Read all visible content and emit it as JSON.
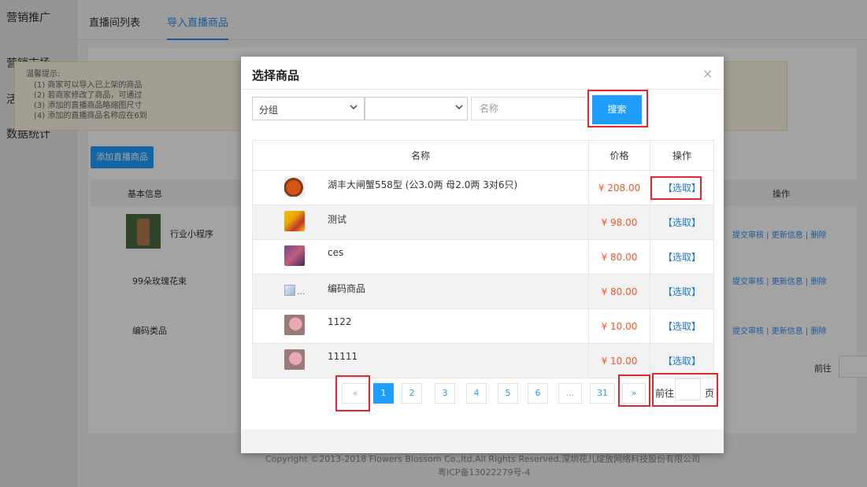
{
  "sidebar": {
    "items": [
      {
        "label": "营销推广"
      },
      {
        "label": "营销市场"
      },
      {
        "label": "活动管理"
      },
      {
        "label": "数据统计"
      }
    ]
  },
  "topbar": {
    "tabs": [
      {
        "label": "直播间列表",
        "active": false
      },
      {
        "label": "导入直播商品",
        "active": true
      }
    ]
  },
  "tips": {
    "title": "温馨提示:",
    "lines": [
      "(1) 商家可以导入已上架的商品",
      "(2) 若商家修改了商品，可通过",
      "(3) 添加的直播商品略缩图尺寸",
      "(4) 添加的直播商品名称应在6到"
    ]
  },
  "background_table": {
    "add_button": "添加直播商品",
    "col_basic": "基本信息",
    "col_op": "操作",
    "rows": [
      {
        "name": "行业小程序"
      },
      {
        "name": "99朵玫瑰花束"
      },
      {
        "name": "编码类品"
      }
    ],
    "row_links": "提交审核 | 更新信息 | 删除",
    "goto_label": "前往"
  },
  "footer": {
    "copyright": "Copyright ©2013-2018 Flowers Blossom Co.,ltd.All Rights Reserved.深圳花儿绽放网络科技股份有限公司",
    "icp": "粤ICP备13022279号-4"
  },
  "modal": {
    "title": "选择商品",
    "close": "×",
    "filter": {
      "group_value": "分组",
      "subgroup_value": "",
      "name_placeholder": "名称",
      "search_label": "搜索"
    },
    "table": {
      "headers": {
        "name": "名称",
        "price": "价格",
        "op": "操作"
      },
      "rows": [
        {
          "name": "湖丰大闸蟹558型 (公3.0两 母2.0两 3对6只)",
          "price": "¥ 208.00",
          "op": "【选取】",
          "thumb": "crab-image"
        },
        {
          "name": "测试",
          "price": "¥ 98.00",
          "op": "【选取】",
          "thumb": "yellow-food-image"
        },
        {
          "name": "ces",
          "price": "¥ 80.00",
          "op": "【选取】",
          "thumb": "purple-product-image"
        },
        {
          "name": "编码商品",
          "price": "¥ 80.00",
          "op": "【选取】",
          "thumb": "broken-image",
          "broken_alt": "..."
        },
        {
          "name": "1122",
          "price": "¥ 10.00",
          "op": "【选取】",
          "thumb": "pink-flower-image"
        },
        {
          "name": "11111",
          "price": "¥ 10.00",
          "op": "【选取】",
          "thumb": "pink-flower-image"
        }
      ]
    },
    "pagination": {
      "prev": "«",
      "pages": [
        "1",
        "2",
        "3",
        "4",
        "5",
        "6",
        "...",
        "31"
      ],
      "current": "1",
      "next": "»",
      "goto_label": "前往",
      "goto_value": "",
      "unit": "页"
    }
  },
  "colors": {
    "primary": "#1e9fff",
    "price": "#f05a28",
    "highlight": "#e6262e",
    "link": "#1e78d6"
  }
}
